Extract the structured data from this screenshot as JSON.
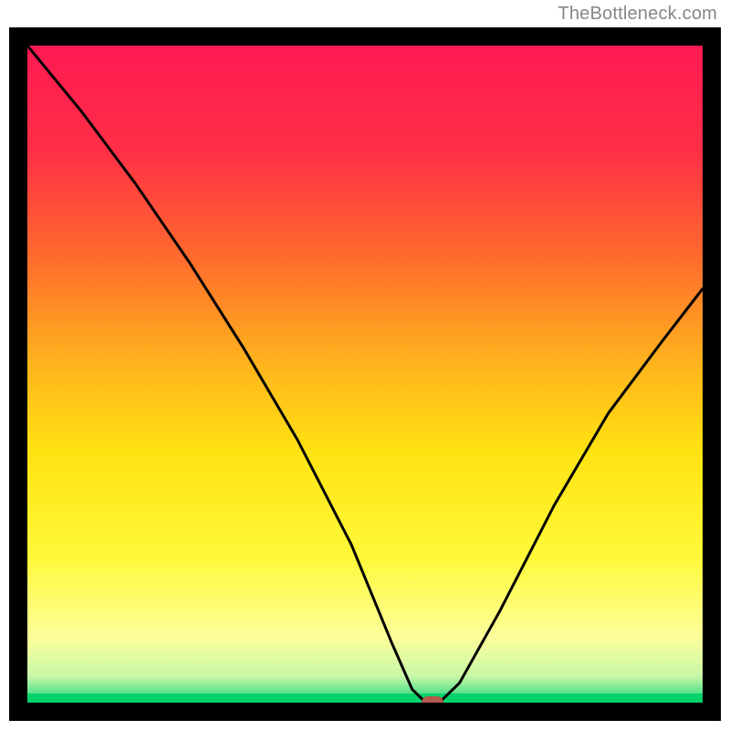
{
  "watermark": "TheBottleneck.com",
  "chart_data": {
    "type": "line",
    "title": "",
    "xlabel": "",
    "ylabel": "",
    "xlim": [
      0,
      100
    ],
    "ylim": [
      0,
      100
    ],
    "x": [
      0,
      8,
      16,
      24,
      32,
      40,
      48,
      54,
      57,
      59,
      61,
      64,
      70,
      78,
      86,
      94,
      100
    ],
    "y": [
      100,
      90,
      79,
      67,
      54,
      40,
      24,
      9,
      2,
      0,
      0,
      3,
      14,
      30,
      44,
      55,
      63
    ],
    "marker": {
      "x": 60,
      "y": 0
    },
    "gradient_stops": [
      {
        "pct": 0,
        "color": "#ff1a53"
      },
      {
        "pct": 16,
        "color": "#ff2f45"
      },
      {
        "pct": 32,
        "color": "#ff6a2e"
      },
      {
        "pct": 48,
        "color": "#ffb21d"
      },
      {
        "pct": 62,
        "color": "#ffe312"
      },
      {
        "pct": 78,
        "color": "#fff93a"
      },
      {
        "pct": 90,
        "color": "#fcff9a"
      },
      {
        "pct": 96,
        "color": "#c8f7a8"
      },
      {
        "pct": 98.8,
        "color": "#4fe089"
      },
      {
        "pct": 100,
        "color": "#03d36b"
      }
    ]
  }
}
